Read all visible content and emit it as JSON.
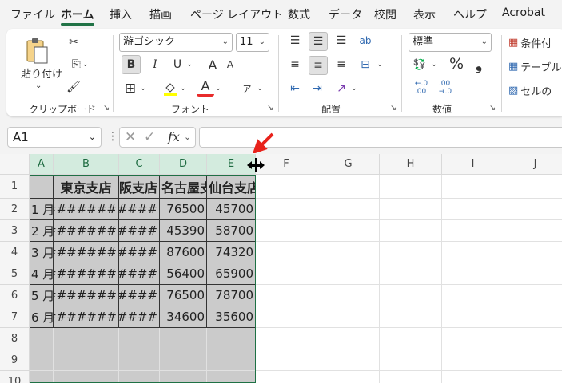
{
  "menu": {
    "tabs": [
      "ファイル",
      "ホーム",
      "挿入",
      "描画",
      "ページ レイアウト",
      "数式",
      "データ",
      "校閲",
      "表示",
      "ヘルプ",
      "Acrobat"
    ],
    "active": "ホーム"
  },
  "ribbon": {
    "clipboard": {
      "paste_label": "貼り付け",
      "group_label": "クリップボード"
    },
    "font": {
      "font_name": "游ゴシック",
      "font_size": "11",
      "bold": "B",
      "italic": "I",
      "underline": "U",
      "grow": "A",
      "shrink": "A",
      "phonetic": "ア",
      "group_label": "フォント"
    },
    "alignment": {
      "group_label": "配置"
    },
    "number": {
      "format": "標準",
      "percent": "%",
      "comma": "❟",
      "group_label": "数値"
    },
    "styles": {
      "conditional": "条件付",
      "table": "テーブル",
      "cell": "セルの"
    }
  },
  "formula_bar": {
    "name_box": "A1",
    "fx": "fx"
  },
  "grid": {
    "columns": [
      "A",
      "B",
      "C",
      "D",
      "E",
      "F",
      "G",
      "H",
      "I",
      "J"
    ],
    "rows": [
      "1",
      "2",
      "3",
      "4",
      "5",
      "6",
      "7",
      "8",
      "9",
      "10"
    ],
    "header_row": [
      "",
      "東京支店",
      "大阪支店",
      "名古屋支店",
      "仙台支店"
    ],
    "data": [
      [
        "1 月",
        "#######",
        "####",
        "76500",
        "45700"
      ],
      [
        "2 月",
        "#######",
        "####",
        "45390",
        "58700"
      ],
      [
        "3 月",
        "#######",
        "####",
        "87600",
        "74320"
      ],
      [
        "4 月",
        "#######",
        "####",
        "56400",
        "65900"
      ],
      [
        "5 月",
        "#######",
        "####",
        "76500",
        "78700"
      ],
      [
        "6 月",
        "#######",
        "####",
        "34600",
        "35600"
      ]
    ]
  },
  "colors": {
    "accent": "#217346",
    "selection": "#cbcbcb",
    "header_selected": "#d3ebde",
    "callout": "#e8221b"
  }
}
